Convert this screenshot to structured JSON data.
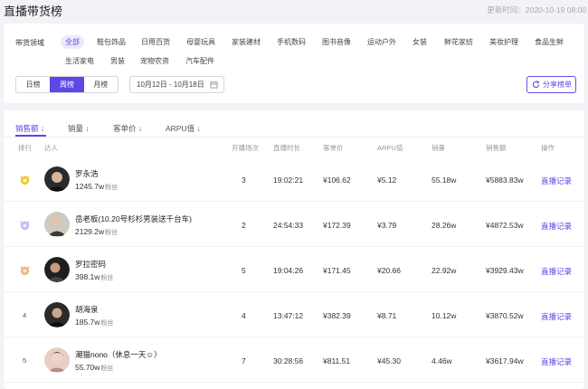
{
  "header": {
    "title": "直播带货榜",
    "update_time": "更新时间：2020-10-19 08:00"
  },
  "filters": {
    "field_label": "带货领域",
    "categories": [
      "全部",
      "鞋包饰品",
      "日用百货",
      "母婴玩具",
      "家装建材",
      "手机数码",
      "图书音像",
      "运动户外",
      "女装",
      "鲜花家纺",
      "美妆护理",
      "食品生鲜",
      "生活家电",
      "男装",
      "宠物农资",
      "汽车配件"
    ],
    "active_category": "全部",
    "periods": [
      "日榜",
      "周榜",
      "月榜"
    ],
    "active_period": "周榜",
    "date_range": "10月12日 - 10月18日",
    "share_label": "分享榜单"
  },
  "sort_tabs": [
    "销售额 ↓",
    "销量 ↓",
    "客单价 ↓",
    "ARPU值 ↓"
  ],
  "table": {
    "headers": {
      "rank": "排行",
      "streamer": "达人",
      "sessions": "开播场次",
      "duration": "直播时长",
      "unit_price": "客单价",
      "arpu": "ARPU值",
      "volume": "销量",
      "sales": "销售额",
      "action": "操作"
    },
    "fans_unit": "粉丝",
    "action_label": "直播记录",
    "rows": [
      {
        "rank": "1",
        "name": "罗永浩",
        "fans": "1245.7w",
        "sessions": "3",
        "duration": "19:02:21",
        "unit_price": "¥106.62",
        "arpu": "¥5.12",
        "volume": "55.18w",
        "sales": "¥5883.83w"
      },
      {
        "rank": "2",
        "name": "岳老板(10.20号杉杉男装送千台车)",
        "fans": "2129.2w",
        "sessions": "2",
        "duration": "24:54:33",
        "unit_price": "¥172.39",
        "arpu": "¥3.79",
        "volume": "28.26w",
        "sales": "¥4872.53w"
      },
      {
        "rank": "3",
        "name": "罗拉密码",
        "fans": "398.1w",
        "sessions": "5",
        "duration": "19:04:26",
        "unit_price": "¥171.45",
        "arpu": "¥20.66",
        "volume": "22.92w",
        "sales": "¥3929.43w"
      },
      {
        "rank": "4",
        "name": "胡海泉",
        "fans": "185.7w",
        "sessions": "4",
        "duration": "13:47:12",
        "unit_price": "¥382.39",
        "arpu": "¥8.71",
        "volume": "10.12w",
        "sales": "¥3870.52w"
      },
      {
        "rank": "5",
        "name": "潮猫nono（休息一天☺）",
        "fans": "55.70w",
        "sessions": "7",
        "duration": "30:28:56",
        "unit_price": "¥811.51",
        "arpu": "¥45.30",
        "volume": "4.46w",
        "sales": "¥3617.94w"
      }
    ]
  },
  "colors": {
    "accent": "#5b48e6",
    "gold": "#f2c230",
    "silver": "#b8bdf0",
    "bronze": "#e8b77a"
  }
}
